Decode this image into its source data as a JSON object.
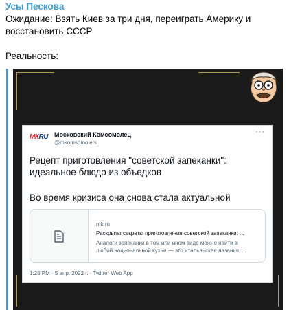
{
  "message": {
    "author": "Усы Пескова",
    "text_line1": "Ожидание: Взять Киев за три дня, переиграть Америку и",
    "text_line2": "восстановить СССР",
    "text_line3": "Реальность:"
  },
  "tweet": {
    "logo": {
      "left": "МК",
      "right": "RU"
    },
    "account_name": "Московский Комсомолец",
    "handle": "@mkomsomolets",
    "more": "···",
    "text_line1": "Рецепт приготовления \"советской запеканки\":",
    "text_line2": "идеальное блюдо из объедков",
    "text_line3": "Во время кризиса она снова стала актуальной",
    "card": {
      "domain": "mk.ru",
      "title": "Раскрыты секреты приготовления советской запеканки: ...",
      "desc_line1": "Аналоги запеканки в том или ином виде можно найти в",
      "desc_line2": "любой национальной кухне — это итальянская лазанья, ..."
    },
    "meta": "1:25 PM · 5 апр. 2022 г. · Twitter Web App"
  },
  "colors": {
    "accent": "#3a9ddb",
    "frame": "#b39a5a",
    "media_bg": "#1b1b1b"
  }
}
